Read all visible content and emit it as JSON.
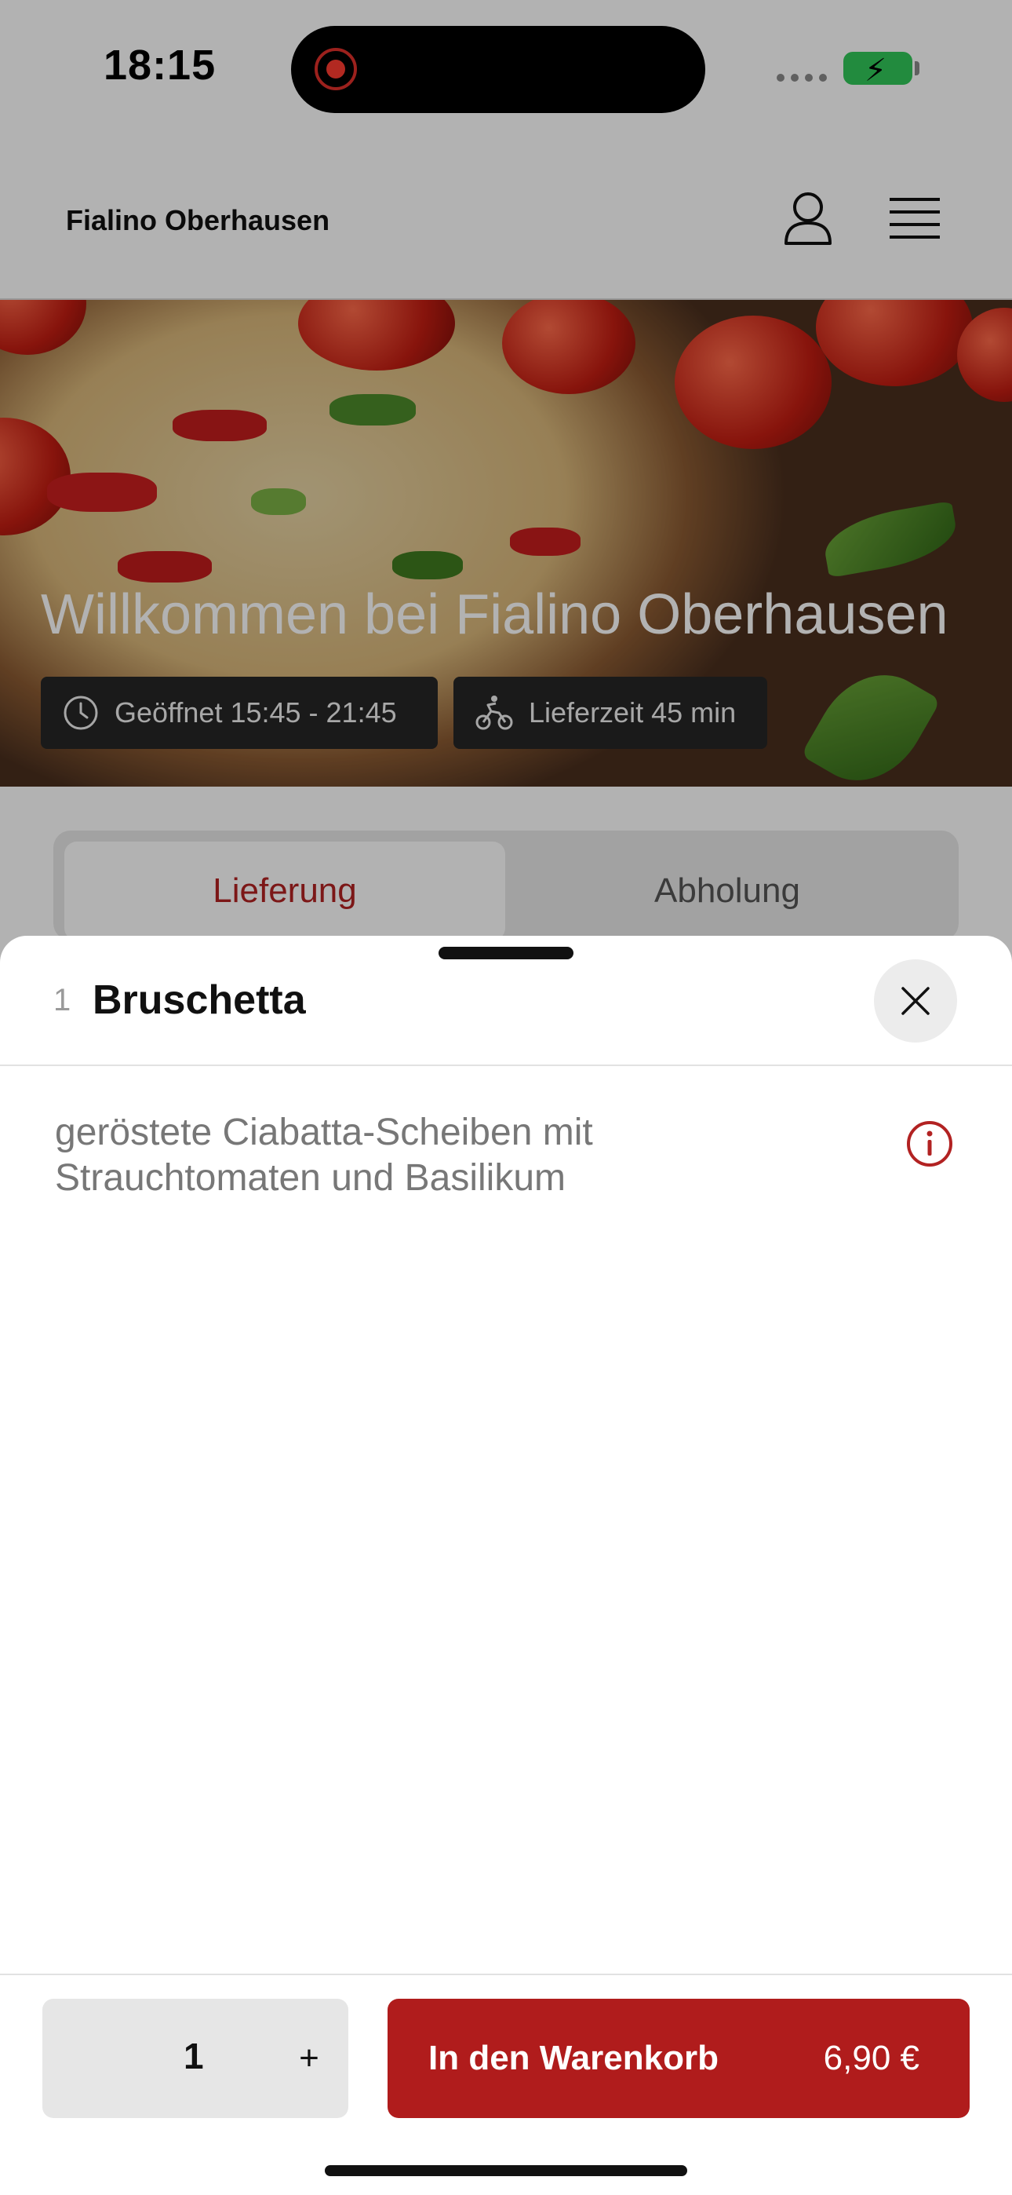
{
  "status_bar": {
    "time": "18:15"
  },
  "header": {
    "restaurant_name": "Fialino Oberhausen"
  },
  "hero": {
    "title": "Willkommen bei Fialino Oberhausen",
    "opening_hours": "Geöffnet 15:45 - 21:45",
    "delivery_time": "Lieferzeit 45 min"
  },
  "tabs": [
    {
      "label": "Lieferung",
      "active": true
    },
    {
      "label": "Abholung",
      "active": false
    }
  ],
  "product_sheet": {
    "number": "1",
    "title": "Bruschetta",
    "description": "geröstete Ciabatta-Scheiben mit Strauchtomaten und Basilikum",
    "quantity": "1",
    "plus_label": "+",
    "add_to_cart_label": "In den Warenkorb",
    "price": "6,90 €"
  },
  "colors": {
    "accent": "#b01c1c",
    "info": "#b22222"
  },
  "icons": [
    "user-icon",
    "menu-icon",
    "clock-icon",
    "bike-icon",
    "close-icon",
    "info-icon"
  ]
}
